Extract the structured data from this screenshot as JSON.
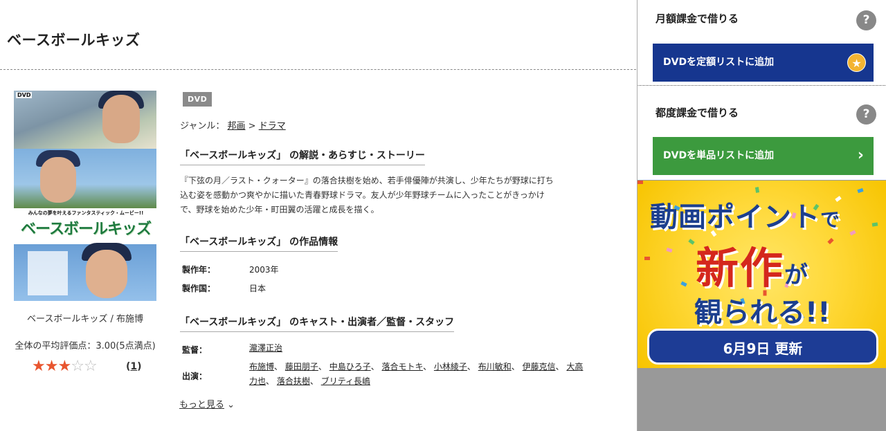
{
  "page": {
    "title": "ベースボールキッズ"
  },
  "cover": {
    "dvd_logo": "DVD",
    "tagline": "みんなの夢を叶えるファンタスティック・ムービー!!",
    "logo_text": "ベースボールキッズ",
    "caption": "ベースボールキッズ / 布施博"
  },
  "rating": {
    "average_text": "全体の平均評価点：3.00(5点満点)",
    "value": 3,
    "max": 5,
    "review_count_open": "(",
    "review_count": "1",
    "review_count_close": ")"
  },
  "badge": "DVD",
  "genre": {
    "label": "ジャンル：",
    "items": [
      "邦画",
      "ドラマ"
    ],
    "separator": ">"
  },
  "synopsis": {
    "heading": "「ベースボールキッズ」 の解説・あらすじ・ストーリー",
    "lines": [
      "『下弦の月／ラスト・クォーター』の落合扶樹を始め、若手俳優陣が共演し、少年たちが野球に打ち",
      "込む姿を感動かつ爽やかに描いた青春野球ドラマ。友人が少年野球チームに入ったことがきっかけ",
      "で、野球を始めた少年・町田翼の活躍と成長を描く。"
    ]
  },
  "work_info": {
    "heading": "「ベースボールキッズ」 の作品情報",
    "rows": [
      {
        "label": "製作年：",
        "value": "2003年"
      },
      {
        "label": "製作国：",
        "value": "日本"
      }
    ]
  },
  "credits": {
    "heading": "「ベースボールキッズ」 のキャスト・出演者／監督・スタッフ",
    "director_label": "監督：",
    "director": "瀧澤正治",
    "cast_label": "出演：",
    "cast": [
      "布施博",
      "藤田朋子",
      "中島ひろ子",
      "落合モトキ",
      "小林綾子",
      "布川敏和",
      "伊藤克信",
      "大高力也",
      "落合扶樹",
      "ブリティ長嶋"
    ],
    "more": "もっと見る"
  },
  "sidebar": {
    "monthly": {
      "heading": "月額課金で借りる",
      "help": "?",
      "button": "DVDを定額リストに追加",
      "button_icon": "star-icon"
    },
    "per_rental": {
      "heading": "都度課金で借りる",
      "help": "?",
      "button": "DVDを単品リストに追加",
      "button_icon": "chevron-right-icon"
    },
    "banner": {
      "line1_a": "動画ポイント",
      "line1_b": "で",
      "line2_a": "新作",
      "line2_b": "が",
      "line3": "観られる!!",
      "update": "6月9日 更新"
    }
  },
  "colors": {
    "button_blue": "#16368f",
    "button_green": "#3c9a3e",
    "star_rating": "#e8552f",
    "banner_yellow": "#ffd93a",
    "banner_red": "#d4271d"
  }
}
